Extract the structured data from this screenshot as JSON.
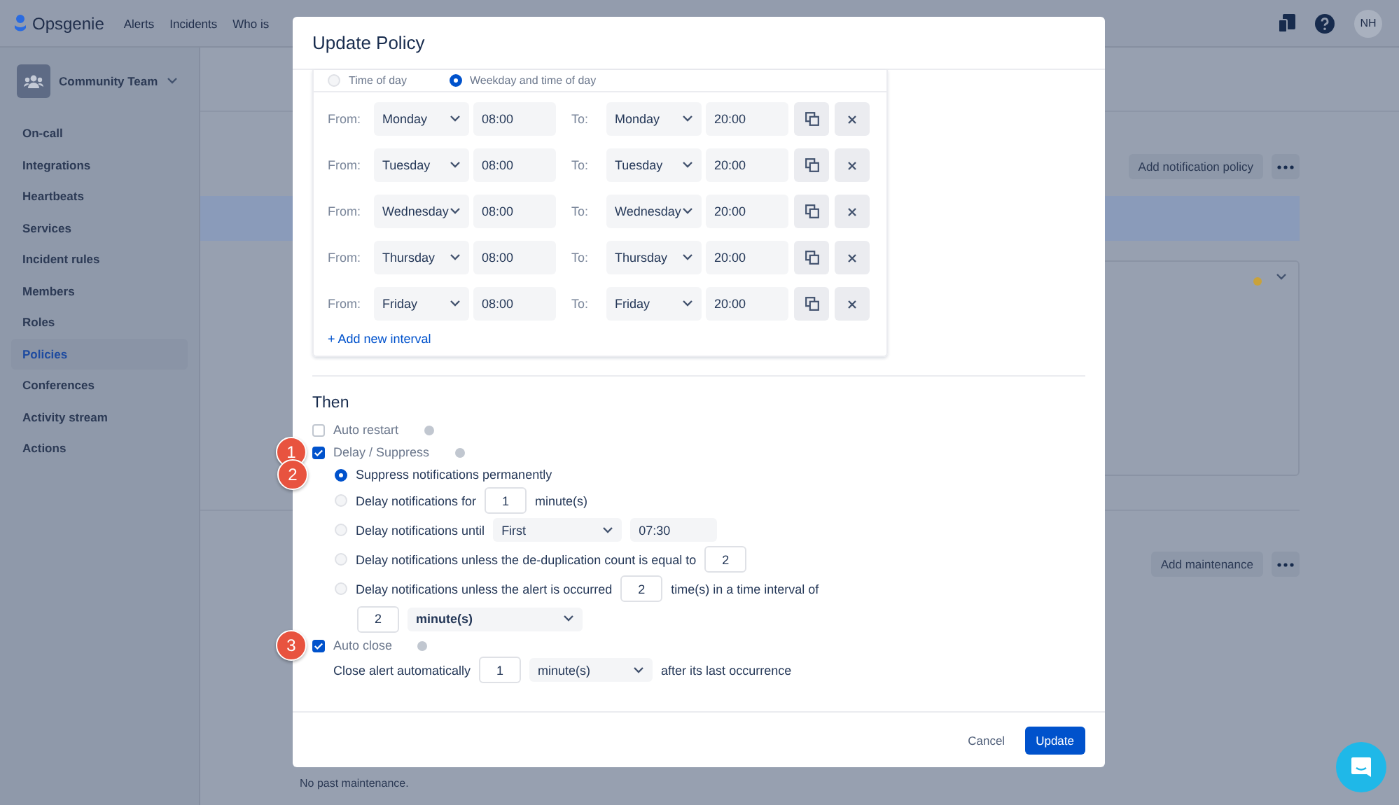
{
  "app": {
    "logo": "Opsgenie",
    "nav": [
      "Alerts",
      "Incidents",
      "Who is"
    ],
    "avatar": "NH"
  },
  "sidebar": {
    "team": "Community Team",
    "items": [
      {
        "label": "On-call",
        "selected": false
      },
      {
        "label": "Integrations",
        "selected": false
      },
      {
        "label": "Heartbeats",
        "selected": false
      },
      {
        "label": "Services",
        "selected": false
      },
      {
        "label": "Incident rules",
        "selected": false
      },
      {
        "label": "Members",
        "selected": false
      },
      {
        "label": "Roles",
        "selected": false
      },
      {
        "label": "Policies",
        "selected": true
      },
      {
        "label": "Conferences",
        "selected": false
      },
      {
        "label": "Activity stream",
        "selected": false
      },
      {
        "label": "Actions",
        "selected": false
      }
    ]
  },
  "page": {
    "policy_button": "Add notification policy",
    "maintenance_button": "Add maintenance",
    "empty_text": "No past maintenance."
  },
  "dialog": {
    "title": "Update Policy",
    "time_options": [
      {
        "label": "Time of day",
        "selected": false
      },
      {
        "label": "Weekday and time of day",
        "selected": true
      }
    ],
    "intervals": [
      {
        "from_label": "From:",
        "from_day": "Monday",
        "from_time": "08:00",
        "to_label": "To:",
        "to_day": "Monday",
        "to_time": "20:00"
      },
      {
        "from_label": "From:",
        "from_day": "Tuesday",
        "from_time": "08:00",
        "to_label": "To:",
        "to_day": "Tuesday",
        "to_time": "20:00"
      },
      {
        "from_label": "From:",
        "from_day": "Wednesday",
        "from_time": "08:00",
        "to_label": "To:",
        "to_day": "Wednesday",
        "to_time": "20:00"
      },
      {
        "from_label": "From:",
        "from_day": "Thursday",
        "from_time": "08:00",
        "to_label": "To:",
        "to_day": "Thursday",
        "to_time": "20:00"
      },
      {
        "from_label": "From:",
        "from_day": "Friday",
        "from_time": "08:00",
        "to_label": "To:",
        "to_day": "Friday",
        "to_time": "20:00"
      }
    ],
    "add_interval": "+ Add new interval",
    "then": {
      "heading": "Then",
      "auto_restart": {
        "label": "Auto restart",
        "checked": false
      },
      "delay": {
        "label": "Delay / Suppress",
        "checked": true,
        "badge": "1",
        "modes": [
          {
            "kind": "plain",
            "label": "Suppress notifications permanently",
            "selected": true,
            "badge": "2"
          },
          {
            "kind": "for",
            "label": "Delay notifications for",
            "selected": false,
            "value": "1",
            "unit": "minute(s)"
          },
          {
            "kind": "until",
            "label": "Delay notifications until",
            "selected": false,
            "day": "First",
            "time": "07:30"
          },
          {
            "kind": "count",
            "label": "Delay notifications unless the de-duplication count is equal to",
            "selected": false,
            "value": "2"
          },
          {
            "kind": "occurred",
            "label": "Delay notifications unless the alert is occurred",
            "selected": false,
            "value": "2",
            "suffix": "time(s) in a time interval of",
            "interval": "2",
            "interval_unit": "minute(s)"
          }
        ]
      },
      "auto_close": {
        "label": "Auto close",
        "checked": true,
        "badge": "3",
        "text": "Close alert automatically",
        "value": "1",
        "unit": "minute(s)",
        "suffix": "after its last occurrence"
      }
    },
    "cancel": "Cancel",
    "submit": "Update"
  }
}
